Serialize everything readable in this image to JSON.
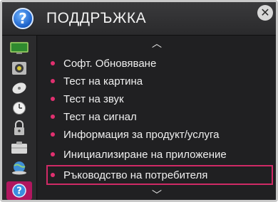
{
  "header": {
    "title": "ПОДДРЪЖКА",
    "help_glyph": "?",
    "close_glyph": "✕"
  },
  "sidebar": {
    "items": [
      {
        "icon": "picture-icon"
      },
      {
        "icon": "sound-icon"
      },
      {
        "icon": "channel-icon"
      },
      {
        "icon": "time-icon"
      },
      {
        "icon": "lock-icon"
      },
      {
        "icon": "option-icon"
      },
      {
        "icon": "network-icon"
      },
      {
        "icon": "support-icon",
        "active": true,
        "glyph": "?"
      }
    ]
  },
  "menu": {
    "scroll_up_glyph": "︿",
    "scroll_down_glyph": "﹀",
    "items": [
      {
        "label": "Софт. Обновяване"
      },
      {
        "label": "Тест на картина"
      },
      {
        "label": "Тест на звук"
      },
      {
        "label": "Тест на сигнал"
      },
      {
        "label": "Информация за продукт/услуга"
      },
      {
        "label": "Инициализиране на приложение"
      },
      {
        "label": "Ръководство на потребителя",
        "selected": true
      }
    ]
  },
  "colors": {
    "accent": "#d02a66",
    "active_tab": "#b0175f",
    "background": "#202022"
  }
}
